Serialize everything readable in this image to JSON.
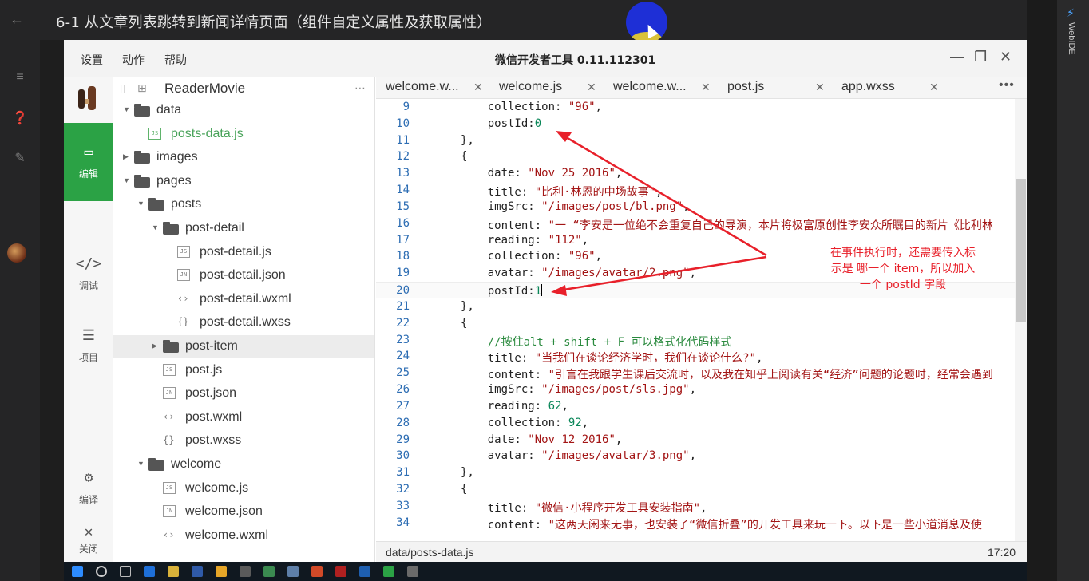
{
  "video": {
    "title": "6-1 从文章列表跳转到新闻详情页面（组件自定义属性及获取属性）",
    "right_label": "WebIDE"
  },
  "ide": {
    "menu": [
      "设置",
      "动作",
      "帮助"
    ],
    "title": "微信开发者工具 0.11.112301"
  },
  "activity": [
    {
      "label": "编辑",
      "icon": "editor-icon",
      "active": true
    },
    {
      "label": "调试",
      "icon": "debug-icon",
      "active": false
    },
    {
      "label": "项目",
      "icon": "project-icon",
      "active": false
    },
    {
      "label": "编译",
      "icon": "compile-icon",
      "active": false
    },
    {
      "label": "关闭",
      "icon": "close-icon",
      "active": false
    }
  ],
  "explorer": {
    "project": "ReaderMovie",
    "tree": [
      {
        "name": "data",
        "type": "folder",
        "depth": 0,
        "open": true
      },
      {
        "name": "posts-data.js",
        "type": "js-active",
        "depth": 1
      },
      {
        "name": "images",
        "type": "folder",
        "depth": 0,
        "open": false
      },
      {
        "name": "pages",
        "type": "folder",
        "depth": 0,
        "open": true
      },
      {
        "name": "posts",
        "type": "folder",
        "depth": 1,
        "open": true
      },
      {
        "name": "post-detail",
        "type": "folder",
        "depth": 2,
        "open": true
      },
      {
        "name": "post-detail.js",
        "type": "js",
        "depth": 3
      },
      {
        "name": "post-detail.json",
        "type": "json",
        "depth": 3
      },
      {
        "name": "post-detail.wxml",
        "type": "wxml",
        "depth": 3
      },
      {
        "name": "post-detail.wxss",
        "type": "wxss",
        "depth": 3
      },
      {
        "name": "post-item",
        "type": "folder",
        "depth": 2,
        "open": false,
        "selected": true
      },
      {
        "name": "post.js",
        "type": "js",
        "depth": 2
      },
      {
        "name": "post.json",
        "type": "json",
        "depth": 2
      },
      {
        "name": "post.wxml",
        "type": "wxml",
        "depth": 2
      },
      {
        "name": "post.wxss",
        "type": "wxss",
        "depth": 2
      },
      {
        "name": "welcome",
        "type": "folder",
        "depth": 1,
        "open": true
      },
      {
        "name": "welcome.js",
        "type": "js",
        "depth": 2
      },
      {
        "name": "welcome.json",
        "type": "json",
        "depth": 2
      },
      {
        "name": "welcome.wxml",
        "type": "wxml",
        "depth": 2
      }
    ]
  },
  "tabs": [
    "welcome.w...",
    "welcome.js",
    "welcome.w...",
    "post.js",
    "app.wxss"
  ],
  "code": [
    {
      "n": "9",
      "parts": [
        [
          "k",
          "    collection: "
        ],
        [
          "s",
          "\"96\""
        ],
        [
          "k",
          ","
        ]
      ]
    },
    {
      "n": "10",
      "parts": [
        [
          "k",
          "    postId:"
        ],
        [
          "n",
          "0"
        ]
      ]
    },
    {
      "n": "11",
      "parts": [
        [
          "k",
          "},"
        ]
      ]
    },
    {
      "n": "12",
      "parts": [
        [
          "k",
          "{"
        ]
      ]
    },
    {
      "n": "13",
      "parts": [
        [
          "k",
          "    date: "
        ],
        [
          "s",
          "\"Nov 25 2016\""
        ],
        [
          "k",
          ","
        ]
      ]
    },
    {
      "n": "14",
      "parts": [
        [
          "k",
          "    title: "
        ],
        [
          "s",
          "\"比利·林恩的中场故事\""
        ],
        [
          "k",
          ","
        ]
      ]
    },
    {
      "n": "15",
      "parts": [
        [
          "k",
          "    imgSrc: "
        ],
        [
          "s",
          "\"/images/post/bl.png\""
        ],
        [
          "k",
          ","
        ]
      ]
    },
    {
      "n": "16",
      "parts": [
        [
          "k",
          "    content: "
        ],
        [
          "s",
          "\"一 “李安是一位绝不会重复自己的导演，本片将极富原创性李安众所瞩目的新片《比利林"
        ]
      ]
    },
    {
      "n": "17",
      "parts": [
        [
          "k",
          "    reading: "
        ],
        [
          "s",
          "\"112\""
        ],
        [
          "k",
          ","
        ]
      ]
    },
    {
      "n": "18",
      "parts": [
        [
          "k",
          "    collection: "
        ],
        [
          "s",
          "\"96\""
        ],
        [
          "k",
          ","
        ]
      ]
    },
    {
      "n": "19",
      "parts": [
        [
          "k",
          "    avatar: "
        ],
        [
          "s",
          "\"/images/avatar/2.png\""
        ],
        [
          "k",
          ","
        ]
      ]
    },
    {
      "n": "20",
      "parts": [
        [
          "k",
          "    postId:"
        ],
        [
          "n",
          "1"
        ]
      ],
      "current": true
    },
    {
      "n": "21",
      "parts": [
        [
          "k",
          "},"
        ]
      ]
    },
    {
      "n": "22",
      "parts": [
        [
          "k",
          "{"
        ]
      ]
    },
    {
      "n": "23",
      "parts": [
        [
          "c",
          "    //按住alt + shift + F 可以格式化代码样式"
        ]
      ]
    },
    {
      "n": "24",
      "parts": [
        [
          "k",
          "    title: "
        ],
        [
          "s",
          "\"当我们在谈论经济学时，我们在谈论什么?\""
        ],
        [
          "k",
          ","
        ]
      ]
    },
    {
      "n": "25",
      "parts": [
        [
          "k",
          "    content: "
        ],
        [
          "s",
          "\"引言在我跟学生课后交流时，以及我在知乎上阅读有关“经济”问题的论题时，经常会遇到"
        ]
      ]
    },
    {
      "n": "26",
      "parts": [
        [
          "k",
          "    imgSrc: "
        ],
        [
          "s",
          "\"/images/post/sls.jpg\""
        ],
        [
          "k",
          ","
        ]
      ]
    },
    {
      "n": "27",
      "parts": [
        [
          "k",
          "    reading: "
        ],
        [
          "n",
          "62"
        ],
        [
          "k",
          ","
        ]
      ]
    },
    {
      "n": "28",
      "parts": [
        [
          "k",
          "    collection: "
        ],
        [
          "n",
          "92"
        ],
        [
          "k",
          ","
        ]
      ]
    },
    {
      "n": "29",
      "parts": [
        [
          "k",
          "    date: "
        ],
        [
          "s",
          "\"Nov 12 2016\""
        ],
        [
          "k",
          ","
        ]
      ]
    },
    {
      "n": "30",
      "parts": [
        [
          "k",
          "    avatar: "
        ],
        [
          "s",
          "\"/images/avatar/3.png\""
        ],
        [
          "k",
          ","
        ]
      ]
    },
    {
      "n": "31",
      "parts": [
        [
          "k",
          "},"
        ]
      ]
    },
    {
      "n": "32",
      "parts": [
        [
          "k",
          "{"
        ]
      ]
    },
    {
      "n": "33",
      "parts": [
        [
          "k",
          "    title: "
        ],
        [
          "s",
          "\"微信·小程序开发工具安装指南\""
        ],
        [
          "k",
          ","
        ]
      ]
    },
    {
      "n": "34",
      "parts": [
        [
          "k",
          "    content: "
        ],
        [
          "s",
          "\"这两天闲来无事，也安装了“微信折叠”的开发工具来玩一下。以下是一些小道消息及使"
        ]
      ]
    }
  ],
  "status": {
    "path": "data/posts-data.js",
    "position": "17:20"
  },
  "annotation": {
    "line1": "在事件执行时，还需要传入标",
    "line2": "示是 哪一个 item，所以加入",
    "line3": "一个 postId 字段",
    "color": "#e8202a"
  },
  "colors": {
    "accent": "#2ba245",
    "line_number": "#2d6db3",
    "string": "#a31515"
  }
}
